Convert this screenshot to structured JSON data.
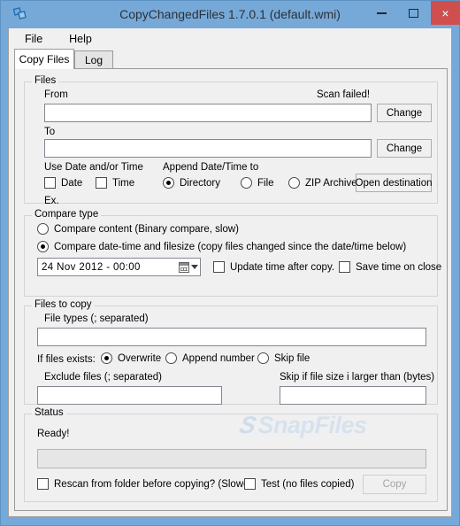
{
  "window": {
    "title": "CopyChangedFiles 1.7.0.1 (default.wmi)",
    "app_icon": "copy-files-icon",
    "titlebar_color": "#76a9d8",
    "close_button_color": "#cf4e4e",
    "controls": {
      "minimize": "minimize-icon",
      "maximize": "maximize-icon",
      "close": "×"
    }
  },
  "menubar": {
    "items": [
      {
        "label": "File"
      },
      {
        "label": "Help"
      }
    ]
  },
  "tabs": [
    {
      "label": "Copy Files",
      "selected": true
    },
    {
      "label": "Log",
      "selected": false
    }
  ],
  "files_group": {
    "title": "Files",
    "from_label": "From",
    "from_value": "",
    "scan_status": "Scan failed!",
    "from_change_button": "Change",
    "to_label": "To",
    "to_value": "",
    "to_change_button": "Change",
    "use_date_time_label": "Use Date and/or Time",
    "date_checkbox": {
      "label": "Date",
      "checked": false
    },
    "time_checkbox": {
      "label": "Time",
      "checked": false
    },
    "append_label": "Append Date/Time to",
    "append_options": [
      {
        "label": "Directory",
        "selected": true
      },
      {
        "label": "File",
        "selected": false
      },
      {
        "label": "ZIP Archive",
        "selected": false
      }
    ],
    "open_destination_button": "Open destination",
    "example_label": "Ex.",
    "example_value": ""
  },
  "compare_group": {
    "title": "Compare type",
    "options": [
      {
        "label": "Compare content (Binary compare, slow)",
        "selected": false
      },
      {
        "label": "Compare date-time and filesize (copy files changed since the date/time below)",
        "selected": true
      }
    ],
    "datetime_value": "24  Nov  2012  -  00:00",
    "calendar_icon": "calendar-icon",
    "dropdown_icon": "chevron-down-icon",
    "update_time_checkbox": {
      "label": "Update time after copy.",
      "checked": false
    },
    "save_time_checkbox": {
      "label": "Save time on close",
      "checked": false
    }
  },
  "copy_group": {
    "title": "Files to copy",
    "file_types_label": "File types (; separated)",
    "file_types_value": "",
    "if_exists_label": "If files exists:",
    "if_exists_options": [
      {
        "label": "Overwrite",
        "selected": true
      },
      {
        "label": "Append number",
        "selected": false
      },
      {
        "label": "Skip file",
        "selected": false
      }
    ],
    "exclude_label": "Exclude files (; separated)",
    "exclude_value": "",
    "skip_size_label": "Skip if file size i larger than (bytes)",
    "skip_size_value": ""
  },
  "status_group": {
    "title": "Status",
    "status_text": "Ready!",
    "progress_percent": 0,
    "rescan_checkbox": {
      "label": "Rescan from folder before copying? (Slower)",
      "checked": false
    },
    "test_checkbox": {
      "label": "Test (no files copied)",
      "checked": false
    },
    "copy_button": {
      "label": "Copy",
      "enabled": false
    }
  },
  "watermark": {
    "mark": "S",
    "text": "SnapFiles"
  }
}
